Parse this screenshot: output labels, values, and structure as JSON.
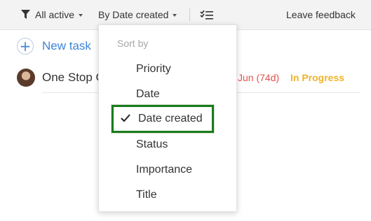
{
  "toolbar": {
    "filter_label": "All active",
    "sort_label": "By Date created",
    "feedback_label": "Leave feedback"
  },
  "new_task": {
    "label": "New task"
  },
  "task": {
    "title": "One Stop G",
    "date": "Jun (74d)",
    "status": "In Progress"
  },
  "sort_menu": {
    "header": "Sort by",
    "items": [
      "Priority",
      "Date",
      "Date created",
      "Status",
      "Importance",
      "Title"
    ],
    "selected": "Date created"
  },
  "colors": {
    "accent": "#3f84d9",
    "overdue": "#e0524e",
    "in_progress": "#f0b429",
    "highlight_border": "#1a7a1a"
  },
  "icons": [
    "filter-icon",
    "caret-down-icon",
    "checklist-icon",
    "plus-icon",
    "checkmark-icon"
  ]
}
